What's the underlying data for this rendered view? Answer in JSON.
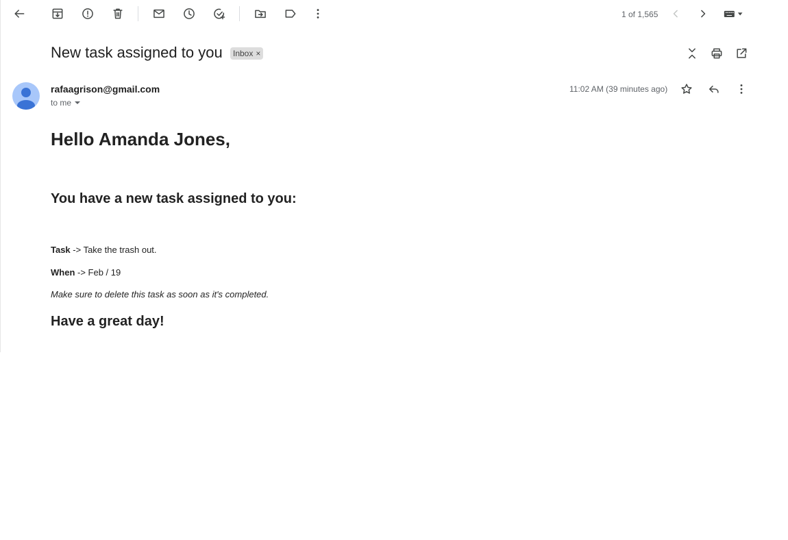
{
  "toolbar": {
    "icons": [
      "back-arrow-icon",
      "archive-icon",
      "report-spam-icon",
      "delete-icon",
      "mark-unread-icon",
      "snooze-icon",
      "add-to-tasks-icon",
      "move-to-icon",
      "label-icon",
      "more-vert-icon"
    ],
    "counter": "1 of 1,565"
  },
  "message": {
    "subject": "New task assigned to you",
    "label": "Inbox",
    "label_remove": "×",
    "sender": "rafaagrison@gmail.com",
    "recipient": "to me",
    "time": "11:02 AM (39 minutes ago)"
  },
  "body": {
    "greeting": "Hello Amanda Jones,",
    "intro": "You have a new task assigned to you:",
    "task_label": "Task",
    "task_value": " -> Take the trash out.",
    "when_label": "When",
    "when_value": " -> Feb / 19",
    "note": "Make sure to delete this task as soon as it's completed.",
    "closing": "Have a great day!"
  },
  "colors": {
    "avatar_bg": "#a8c7fa",
    "avatar_fg": "#3a73d6",
    "icon": "#444746",
    "chip": "#dddddd"
  }
}
